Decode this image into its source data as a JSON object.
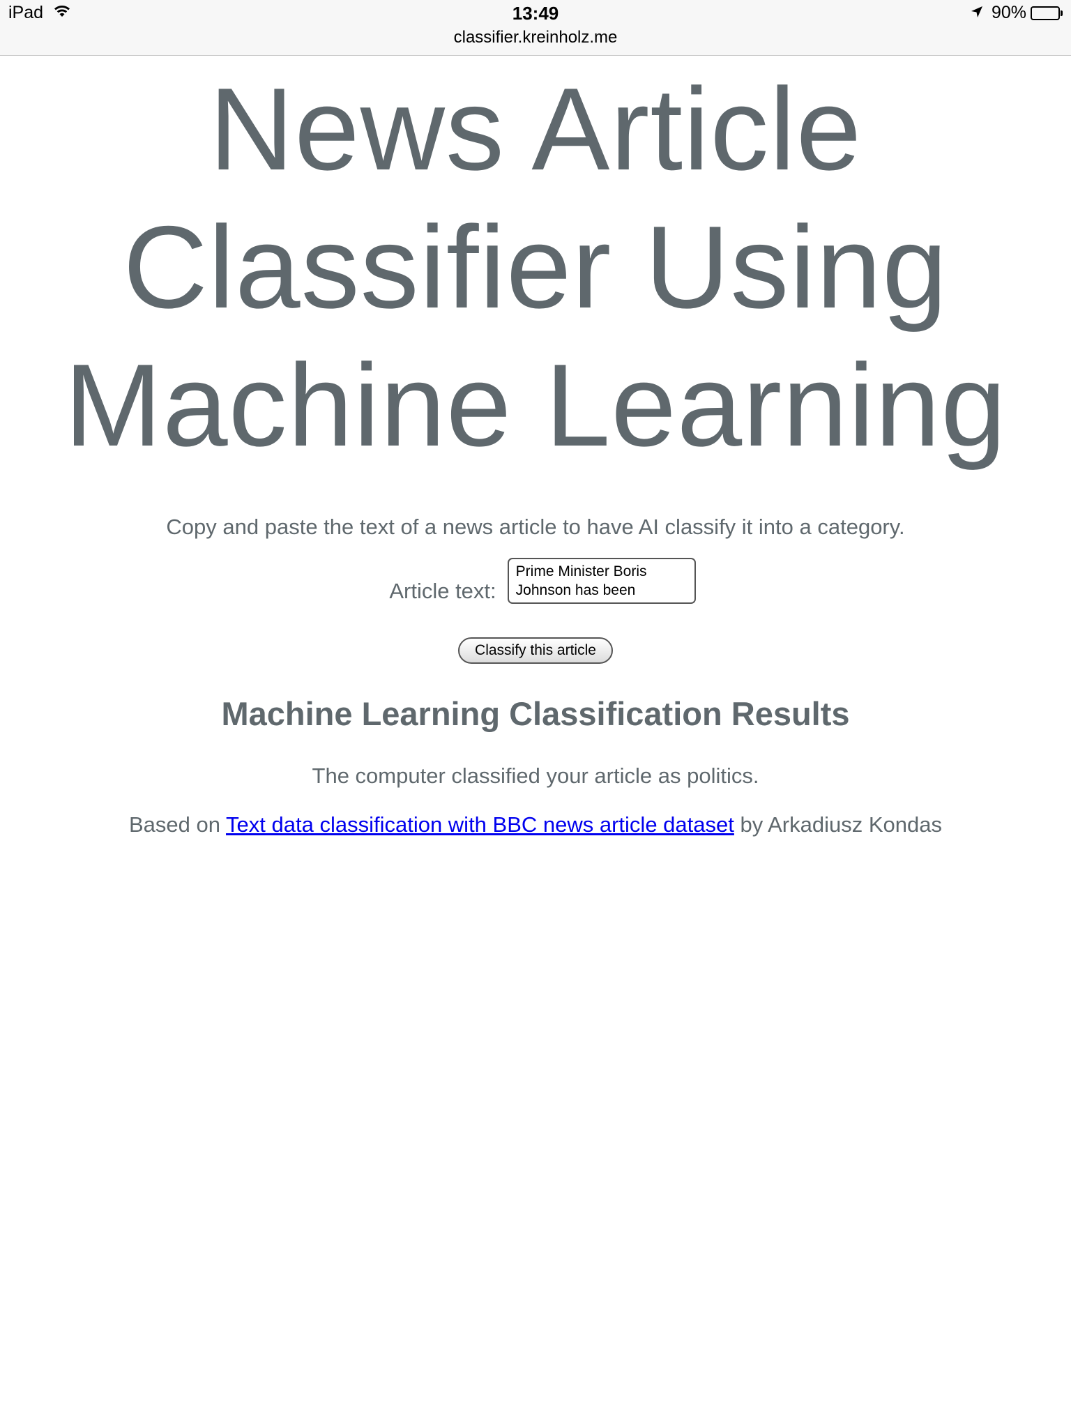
{
  "status_bar": {
    "device": "iPad",
    "time": "13:49",
    "url": "classifier.kreinholz.me",
    "battery_text": "90%",
    "battery_level": 0.9,
    "icons": [
      "wifi-icon",
      "location-arrow-icon",
      "battery-icon"
    ]
  },
  "page": {
    "title_line1": "News Article",
    "title_line2": "Classifier Using",
    "title_line3": "Machine Learning",
    "intro": "Copy and paste the text of a news article to have AI classify it into a category.",
    "form": {
      "label": "Article text:",
      "value_line1": "Prime Minister Boris",
      "value_line2": "Johnson has been",
      "button_label": "Classify this article"
    },
    "results": {
      "heading": "Machine Learning Classification Results",
      "text": "The computer classified your article as politics."
    },
    "credit": {
      "prefix": "Based on ",
      "link_text": "Text data classification with BBC news article dataset",
      "suffix": " by Arkadiusz Kondas"
    }
  },
  "colors": {
    "text": "#5f686d",
    "link": "#0000ee",
    "status_bg": "#f7f7f7"
  }
}
